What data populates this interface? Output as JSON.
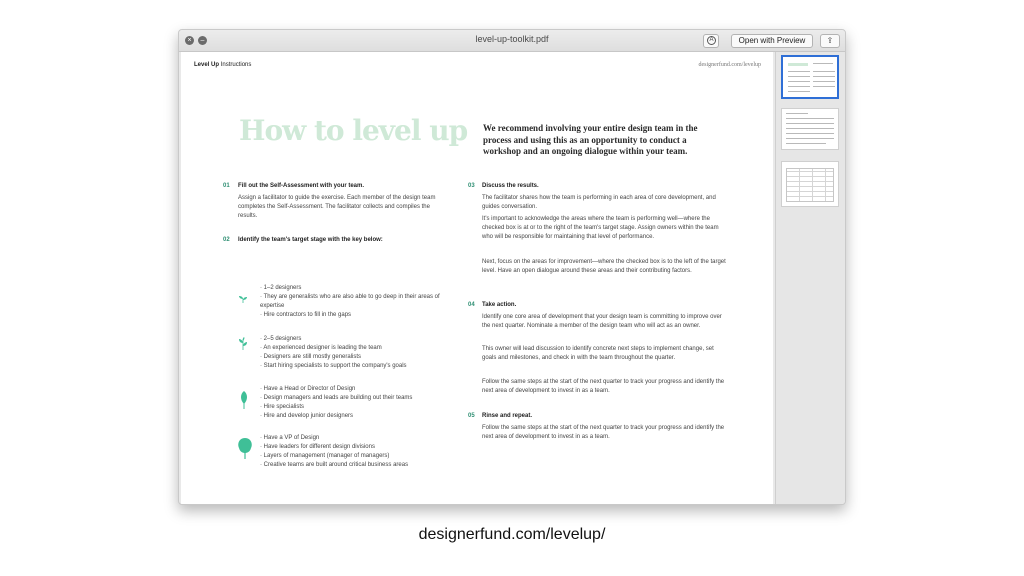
{
  "window": {
    "title": "level-up-toolkit.pdf",
    "close_glyph": "×",
    "minimize_glyph": "–",
    "markup_glyph": "A",
    "open_with_preview": "Open with Preview",
    "share_glyph": "⇪"
  },
  "document": {
    "brand_bold": "Level Up",
    "brand_sub": "Instructions",
    "header_url": "designerfund.com/levelup",
    "headline": "How to level up",
    "headline_color": "#cfe9d7",
    "intro": "We recommend involving your entire design team in the process and using this as an opportunity to conduct a workshop and an ongoing dialogue within your team.",
    "steps": {
      "s01": {
        "num": "01",
        "title": "Fill out the Self-Assessment with your team.",
        "body": "Assign a facilitator to guide the exercise. Each member of the design team completes the Self-Assessment. The facilitator collects and compiles the results."
      },
      "s02": {
        "num": "02",
        "title": "Identify the team's target stage with the key below:"
      },
      "s03": {
        "num": "03",
        "title": "Discuss the results.",
        "p1": "The facilitator shares how the team is performing in each area of core development, and guides conversation.",
        "p2": "It's important to acknowledge the areas where the team is performing well—where the checked box is at or to the right of the team's target stage. Assign owners within the team who will be responsible for maintaining that level of performance.",
        "p3": "Next, focus on the areas for improvement—where the checked box is to the left of the target level. Have an open dialogue around these areas and their contributing factors."
      },
      "s04": {
        "num": "04",
        "title": "Take action.",
        "p1": "Identify one core area of development that your design team is committing to improve over the next quarter. Nominate a member of the design team who will act as an owner.",
        "p2": "This owner will lead discussion to identify concrete next steps to implement change, set goals and milestones, and check in with the team throughout the quarter.",
        "p3": "Follow the same steps at the start of the next quarter to track your progress and identify the next area of development to invest in as a team."
      },
      "s05": {
        "num": "05",
        "title": "Rinse and repeat.",
        "p1": "Follow the same steps at the start of the next quarter to track your progress and identify the next area of development to invest in as a team."
      }
    },
    "stages": [
      {
        "icon": "sprout-icon",
        "items": [
          "1–2 designers",
          "They are generalists who are also able to go deep in their areas of expertise",
          "Hire contractors to fill in the gaps"
        ]
      },
      {
        "icon": "seedling-icon",
        "items": [
          "2–5 designers",
          "An experienced designer is leading the team",
          "Designers are still mostly generalists",
          "Start hiring specialists to support the company's goals"
        ]
      },
      {
        "icon": "sapling-icon",
        "items": [
          "Have a Head or Director of Design",
          "Design managers and leads are building out their teams",
          "Hire specialists",
          "Hire and develop junior designers"
        ]
      },
      {
        "icon": "tree-icon",
        "items": [
          "Have a VP of Design",
          "Have leaders for different design divisions",
          "Layers of management (manager of managers)",
          "Creative teams are built around critical business areas"
        ]
      }
    ],
    "accent_color": "#2f8f73",
    "icon_color": "#3fbf97"
  },
  "caption": "designerfund.com/levelup/"
}
